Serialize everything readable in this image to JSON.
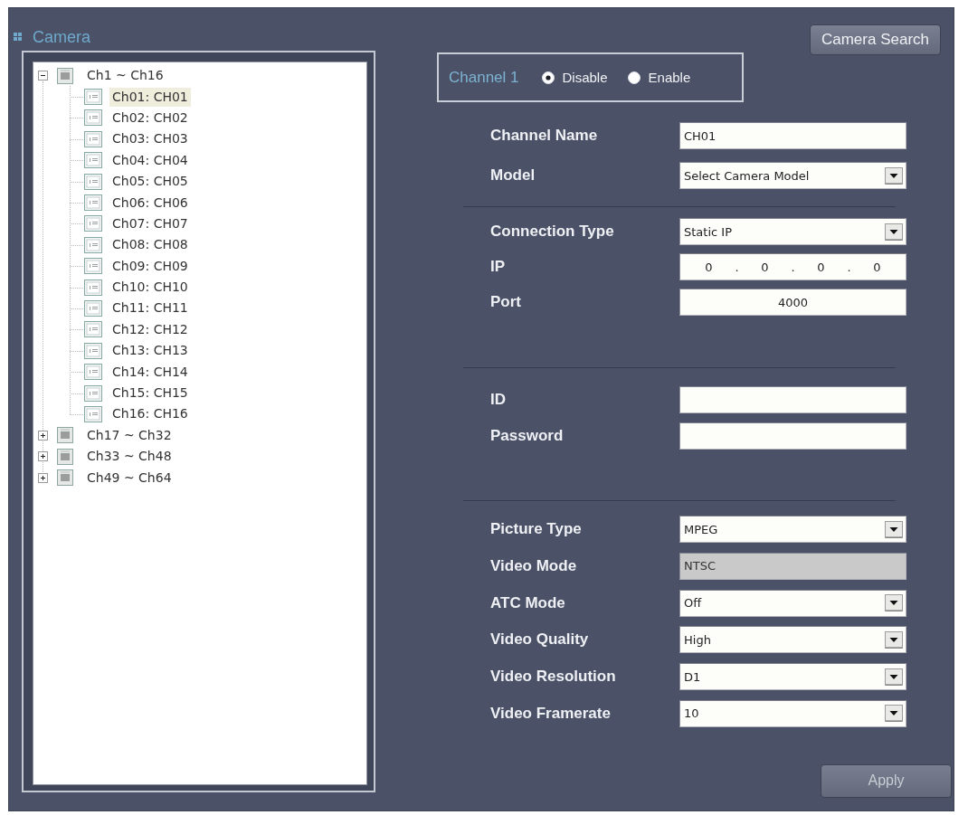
{
  "panel": {
    "title": "Camera"
  },
  "tree": [
    {
      "label": "Ch1 ~ Ch16",
      "expanded": true,
      "selected": false,
      "children": [
        {
          "label": "Ch01: CH01",
          "selected": true
        },
        {
          "label": "Ch02: CH02",
          "selected": false
        },
        {
          "label": "Ch03: CH03",
          "selected": false
        },
        {
          "label": "Ch04: CH04",
          "selected": false
        },
        {
          "label": "Ch05: CH05",
          "selected": false
        },
        {
          "label": "Ch06: CH06",
          "selected": false
        },
        {
          "label": "Ch07: CH07",
          "selected": false
        },
        {
          "label": "Ch08: CH08",
          "selected": false
        },
        {
          "label": "Ch09: CH09",
          "selected": false
        },
        {
          "label": "Ch10: CH10",
          "selected": false
        },
        {
          "label": "Ch11: CH11",
          "selected": false
        },
        {
          "label": "Ch12: CH12",
          "selected": false
        },
        {
          "label": "Ch13: CH13",
          "selected": false
        },
        {
          "label": "Ch14: CH14",
          "selected": false
        },
        {
          "label": "Ch15: CH15",
          "selected": false
        },
        {
          "label": "Ch16: CH16",
          "selected": false
        }
      ]
    },
    {
      "label": "Ch17 ~ Ch32",
      "expanded": false,
      "selected": false
    },
    {
      "label": "Ch33 ~ Ch48",
      "expanded": false,
      "selected": false
    },
    {
      "label": "Ch49 ~ Ch64",
      "expanded": false,
      "selected": false
    }
  ],
  "camera_search_button": {
    "label": "Camera Search"
  },
  "channel": {
    "label": "Channel 1",
    "options": [
      {
        "label": "Disable",
        "selected": true
      },
      {
        "label": "Enable",
        "selected": false
      }
    ]
  },
  "sections": [
    {
      "fields": [
        {
          "label": "Channel Name",
          "kind": "text",
          "value": "CH01",
          "disabled": false
        },
        {
          "label": "Model",
          "kind": "select",
          "value": "Select Camera Model",
          "disabled": false
        }
      ]
    },
    {
      "fields": [
        {
          "label": "Connection Type",
          "kind": "select",
          "value": "Static IP",
          "disabled": false
        },
        {
          "label": "IP",
          "kind": "ip",
          "parts": [
            "0",
            ".",
            "0",
            ".",
            "0",
            ".",
            "0"
          ],
          "disabled": false
        },
        {
          "label": "Port",
          "kind": "number",
          "value": "4000",
          "disabled": false
        }
      ]
    },
    {
      "fields": [
        {
          "label": "ID",
          "kind": "text",
          "disabled": false
        },
        {
          "label": "Password",
          "kind": "text",
          "disabled": false
        }
      ]
    },
    {
      "fields": [
        {
          "label": "Picture Type",
          "kind": "select",
          "value": "MPEG",
          "disabled": false
        },
        {
          "label": "Video Mode",
          "kind": "text",
          "value": "NTSC",
          "disabled": true
        },
        {
          "label": "ATC Mode",
          "kind": "select",
          "value": "Off",
          "disabled": false
        },
        {
          "label": "Video Quality",
          "kind": "select",
          "value": "High",
          "disabled": false
        },
        {
          "label": "Video Resolution",
          "kind": "select",
          "value": "D1",
          "disabled": false
        },
        {
          "label": "Video Framerate",
          "kind": "select",
          "value": "10",
          "disabled": false
        }
      ]
    }
  ],
  "apply_button": {
    "label": "Apply"
  }
}
